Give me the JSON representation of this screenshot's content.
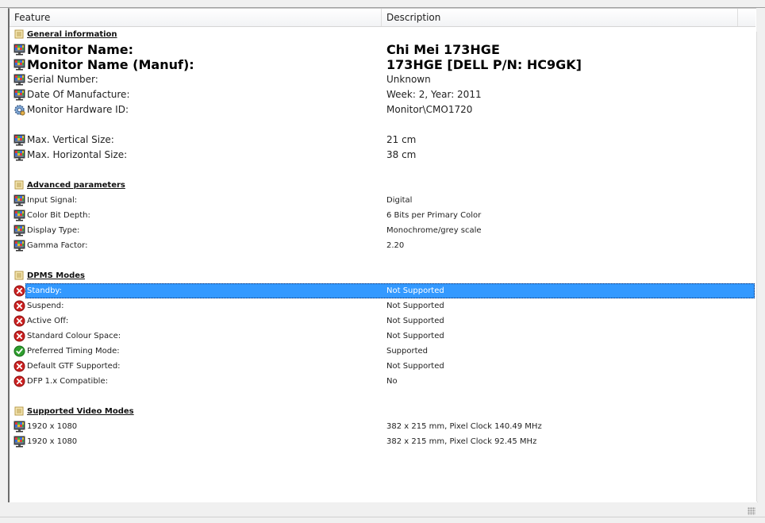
{
  "header": {
    "col_feature": "Feature",
    "col_description": "Description"
  },
  "rows": [
    {
      "type": "section",
      "icon": "folder-icon",
      "feature": "General information",
      "description": ""
    },
    {
      "type": "item",
      "style": "bold",
      "icon": "monitor-icon",
      "feature": "Monitor Name:",
      "description": "Chi Mei 173HGE"
    },
    {
      "type": "item",
      "style": "bold",
      "icon": "monitor-icon",
      "feature": "Monitor Name (Manuf):",
      "description": "173HGE  [DELL P/N: HC9GK]"
    },
    {
      "type": "item",
      "style": "big",
      "icon": "monitor-icon",
      "feature": "Serial Number:",
      "description": "Unknown"
    },
    {
      "type": "item",
      "style": "big",
      "icon": "monitor-icon",
      "feature": "Date Of Manufacture:",
      "description": "Week: 2, Year: 2011"
    },
    {
      "type": "item",
      "style": "big",
      "icon": "hardware-gear-icon",
      "feature": "Monitor Hardware ID:",
      "description": "Monitor\\CMO1720"
    },
    {
      "type": "blank"
    },
    {
      "type": "item",
      "style": "big",
      "icon": "monitor-icon",
      "feature": "Max. Vertical Size:",
      "description": "21 cm"
    },
    {
      "type": "item",
      "style": "big",
      "icon": "monitor-icon",
      "feature": "Max. Horizontal Size:",
      "description": "38 cm"
    },
    {
      "type": "blank"
    },
    {
      "type": "section",
      "icon": "folder-icon",
      "feature": "Advanced parameters",
      "description": ""
    },
    {
      "type": "item",
      "style": "small",
      "icon": "monitor-icon",
      "feature": "Input Signal:",
      "description": "Digital"
    },
    {
      "type": "item",
      "style": "small",
      "icon": "monitor-icon",
      "feature": "Color Bit Depth:",
      "description": "6 Bits per Primary Color"
    },
    {
      "type": "item",
      "style": "small",
      "icon": "monitor-icon",
      "feature": "Display Type:",
      "description": "Monochrome/grey scale"
    },
    {
      "type": "item",
      "style": "small",
      "icon": "monitor-icon",
      "feature": "Gamma Factor:",
      "description": "2.20"
    },
    {
      "type": "blank"
    },
    {
      "type": "section",
      "icon": "folder-icon",
      "feature": "DPMS Modes",
      "description": ""
    },
    {
      "type": "item",
      "style": "small",
      "icon": "error-icon",
      "feature": "Standby:",
      "description": "Not Supported",
      "selected": true
    },
    {
      "type": "item",
      "style": "small",
      "icon": "error-icon",
      "feature": "Suspend:",
      "description": "Not Supported"
    },
    {
      "type": "item",
      "style": "small",
      "icon": "error-icon",
      "feature": "Active Off:",
      "description": "Not Supported"
    },
    {
      "type": "item",
      "style": "small",
      "icon": "error-icon",
      "feature": "Standard Colour Space:",
      "description": "Not Supported"
    },
    {
      "type": "item",
      "style": "small",
      "icon": "check-icon",
      "feature": "Preferred Timing Mode:",
      "description": "Supported"
    },
    {
      "type": "item",
      "style": "small",
      "icon": "error-icon",
      "feature": "Default GTF Supported:",
      "description": "Not Supported"
    },
    {
      "type": "item",
      "style": "small",
      "icon": "error-icon",
      "feature": "DFP 1.x Compatible:",
      "description": "No"
    },
    {
      "type": "blank"
    },
    {
      "type": "section",
      "icon": "folder-icon",
      "feature": "Supported Video Modes",
      "description": ""
    },
    {
      "type": "item",
      "style": "small",
      "icon": "monitor-icon",
      "feature": "1920 x 1080",
      "description": "382 x 215 mm, Pixel Clock 140.49 MHz"
    },
    {
      "type": "item",
      "style": "small",
      "icon": "monitor-icon",
      "feature": "1920 x 1080",
      "description": "382 x 215 mm, Pixel Clock 92.45 MHz"
    }
  ],
  "colors": {
    "selection": "#3399ff",
    "error": "#cc2222",
    "success": "#2e9e2e"
  }
}
